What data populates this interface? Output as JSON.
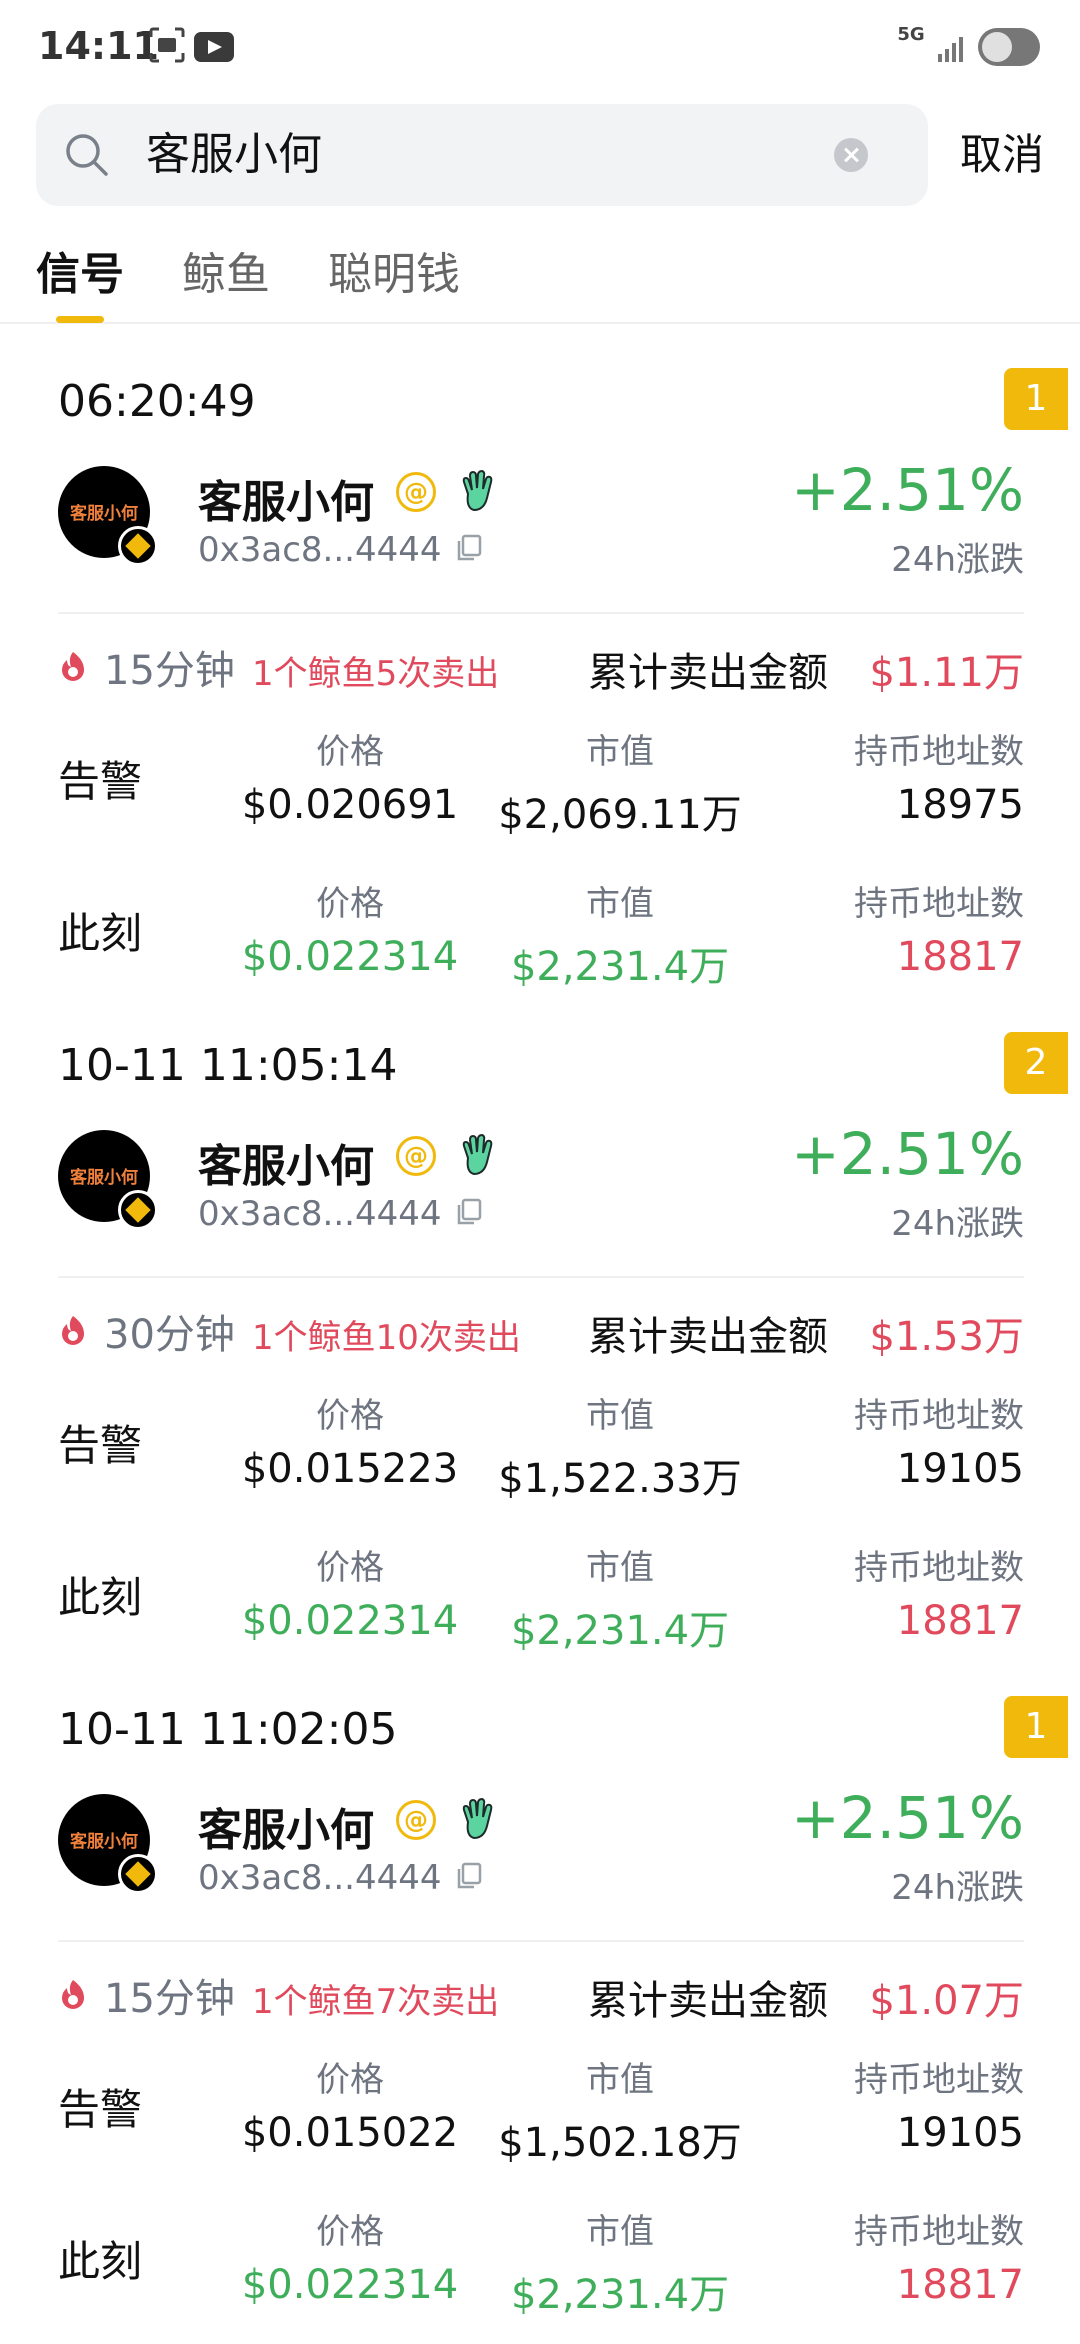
{
  "status_bar": {
    "time": "14:11",
    "network": "5G"
  },
  "search": {
    "value": "客服小何",
    "cancel_label": "取消"
  },
  "tabs": [
    {
      "label": "信号",
      "active": true
    },
    {
      "label": "鲸鱼",
      "active": false
    },
    {
      "label": "聪明钱",
      "active": false
    }
  ],
  "labels": {
    "price": "价格",
    "market_cap": "市值",
    "holders": "持币地址数",
    "alert": "告警",
    "now": "此刻",
    "total_sell": "累计卖出金额",
    "change_24h": "24h涨跌"
  },
  "cards": [
    {
      "time": "06:20:49",
      "rank": "1",
      "avatar_text": "客服小何",
      "name": "客服小何",
      "address": "0x3ac8...4444",
      "change": "+2.51%",
      "duration": "15分钟",
      "activity": "1个鲸鱼5次卖出",
      "total_sell": "$1.11万",
      "alert": {
        "price": "$0.020691",
        "market_cap": "$2,069.11万",
        "holders": "18975"
      },
      "now": {
        "price": "$0.022314",
        "market_cap": "$2,231.4万",
        "holders": "18817"
      }
    },
    {
      "time": "10-11 11:05:14",
      "rank": "2",
      "avatar_text": "客服小何",
      "name": "客服小何",
      "address": "0x3ac8...4444",
      "change": "+2.51%",
      "duration": "30分钟",
      "activity": "1个鲸鱼10次卖出",
      "total_sell": "$1.53万",
      "alert": {
        "price": "$0.015223",
        "market_cap": "$1,522.33万",
        "holders": "19105"
      },
      "now": {
        "price": "$0.022314",
        "market_cap": "$2,231.4万",
        "holders": "18817"
      }
    },
    {
      "time": "10-11 11:02:05",
      "rank": "1",
      "avatar_text": "客服小何",
      "name": "客服小何",
      "address": "0x3ac8...4444",
      "change": "+2.51%",
      "duration": "15分钟",
      "activity": "1个鲸鱼7次卖出",
      "total_sell": "$1.07万",
      "alert": {
        "price": "$0.015022",
        "market_cap": "$1,502.18万",
        "holders": "19105"
      },
      "now": {
        "price": "$0.022314",
        "market_cap": "$2,231.4万",
        "holders": "18817"
      }
    }
  ],
  "colors": {
    "accent": "#f0b90b",
    "up": "#3fae5a",
    "down": "#e04a5c",
    "muted": "#6e7580"
  }
}
